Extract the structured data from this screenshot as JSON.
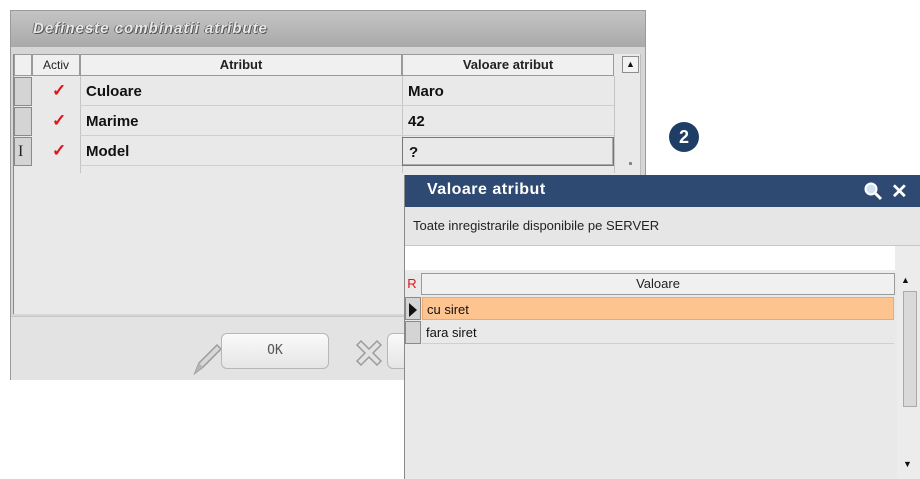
{
  "dialog1": {
    "title": "Defineste combinatii atribute",
    "columns": {
      "activ": "Activ",
      "atribut": "Atribut",
      "valoare": "Valoare atribut"
    },
    "rows": [
      {
        "atribut": "Culoare",
        "valoare": "Maro",
        "activ": true
      },
      {
        "atribut": "Marime",
        "valoare": "42",
        "activ": true
      },
      {
        "atribut": "Model",
        "valoare": "?",
        "activ": true
      }
    ],
    "check_glyph": "✓",
    "ok_label": "OK"
  },
  "badge": "2",
  "dialog2": {
    "title": "Valoare atribut",
    "info_text": "Toate inregistrarile disponibile pe SERVER",
    "r_label": "R",
    "column_header": "Valoare",
    "rows": [
      {
        "value": "cu siret",
        "selected": true
      },
      {
        "value": "fara siret",
        "selected": false
      }
    ],
    "close_glyph": "✕"
  },
  "colors": {
    "title_bar_dark": "#2f4a72",
    "selection": "#fdc48f",
    "check_red": "#e0141b",
    "badge": "#1f3e66"
  },
  "icons": [
    "pencil-icon",
    "cancel-x-icon",
    "search-icon",
    "close-icon",
    "checkmark-icon",
    "row-pointer-icon"
  ]
}
